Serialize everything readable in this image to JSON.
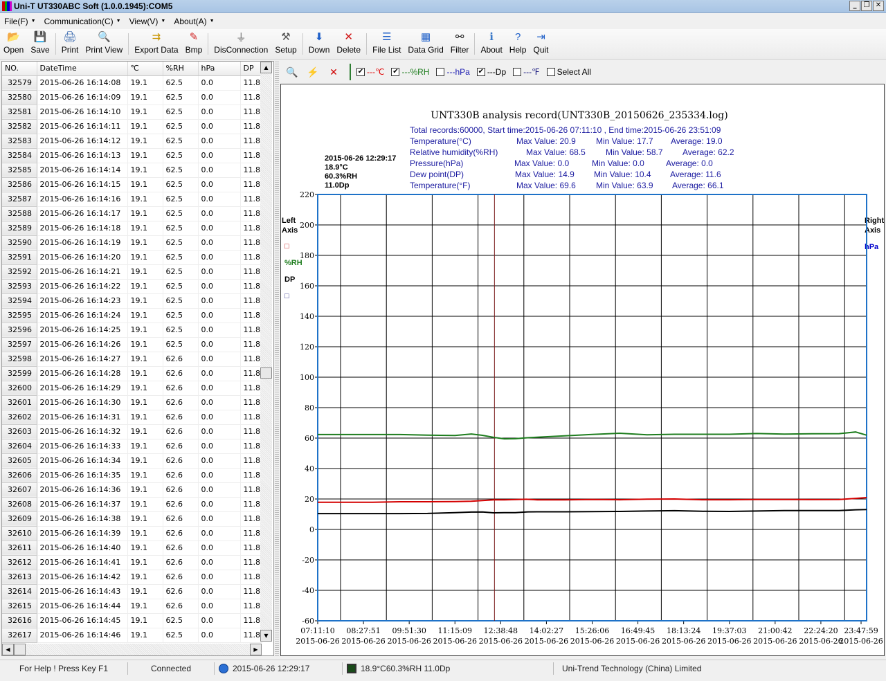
{
  "window": {
    "title": "Uni-T UT330ABC Soft (1.0.0.1945):COM5",
    "controls": {
      "minimize": "_",
      "restore": "❐",
      "close": "✕"
    }
  },
  "menu": [
    {
      "label": "File(F)"
    },
    {
      "label": "Communication(C)"
    },
    {
      "label": "View(V)"
    },
    {
      "label": "About(A)"
    }
  ],
  "toolbar": [
    {
      "id": "open",
      "label": "Open",
      "icon": "folder-open-icon",
      "glyph": "📂"
    },
    {
      "id": "save",
      "label": "Save",
      "icon": "floppy-icon",
      "glyph": "💾"
    },
    {
      "sep": true
    },
    {
      "id": "print",
      "label": "Print",
      "icon": "printer-icon",
      "glyph": "🖨"
    },
    {
      "id": "print-view",
      "label": "Print View",
      "icon": "print-preview-icon",
      "glyph": "🔍"
    },
    {
      "sep": true
    },
    {
      "id": "export-data",
      "label": "Export Data",
      "icon": "export-icon",
      "glyph": "⇉"
    },
    {
      "id": "bmp",
      "label": "Bmp",
      "icon": "paint-icon",
      "glyph": "✎"
    },
    {
      "sep": true
    },
    {
      "id": "disconnection",
      "label": "DisConnection",
      "icon": "usb-plug-icon",
      "glyph": "⏚"
    },
    {
      "id": "setup",
      "label": "Setup",
      "icon": "hammer-icon",
      "glyph": "⚒"
    },
    {
      "sep": true
    },
    {
      "id": "down",
      "label": "Down",
      "icon": "arrow-down-icon",
      "glyph": "⬇"
    },
    {
      "id": "delete",
      "label": "Delete",
      "icon": "delete-x-icon",
      "glyph": "✕"
    },
    {
      "sep": true
    },
    {
      "id": "file-list",
      "label": "File List",
      "icon": "file-tree-icon",
      "glyph": "☰"
    },
    {
      "id": "data-grid",
      "label": "Data Grid",
      "icon": "grid-icon",
      "glyph": "▦"
    },
    {
      "id": "filter",
      "label": "Filter",
      "icon": "binoculars-icon",
      "glyph": "⚯"
    },
    {
      "sep": true
    },
    {
      "id": "about",
      "label": "About",
      "icon": "info-icon",
      "glyph": "ℹ"
    },
    {
      "id": "help",
      "label": "Help",
      "icon": "help-icon",
      "glyph": "?"
    },
    {
      "id": "quit",
      "label": "Quit",
      "icon": "exit-door-icon",
      "glyph": "⇥"
    }
  ],
  "grid": {
    "columns": [
      "NO.",
      "DateTime",
      "℃",
      "%RH",
      "hPa",
      "DP"
    ],
    "rows": [
      [
        "32579",
        "2015-06-26 16:14:08",
        "19.1",
        "62.5",
        "0.0",
        "11.8"
      ],
      [
        "32580",
        "2015-06-26 16:14:09",
        "19.1",
        "62.5",
        "0.0",
        "11.8"
      ],
      [
        "32581",
        "2015-06-26 16:14:10",
        "19.1",
        "62.5",
        "0.0",
        "11.8"
      ],
      [
        "32582",
        "2015-06-26 16:14:11",
        "19.1",
        "62.5",
        "0.0",
        "11.8"
      ],
      [
        "32583",
        "2015-06-26 16:14:12",
        "19.1",
        "62.5",
        "0.0",
        "11.8"
      ],
      [
        "32584",
        "2015-06-26 16:14:13",
        "19.1",
        "62.5",
        "0.0",
        "11.8"
      ],
      [
        "32585",
        "2015-06-26 16:14:14",
        "19.1",
        "62.5",
        "0.0",
        "11.8"
      ],
      [
        "32586",
        "2015-06-26 16:14:15",
        "19.1",
        "62.5",
        "0.0",
        "11.8"
      ],
      [
        "32587",
        "2015-06-26 16:14:16",
        "19.1",
        "62.5",
        "0.0",
        "11.8"
      ],
      [
        "32588",
        "2015-06-26 16:14:17",
        "19.1",
        "62.5",
        "0.0",
        "11.8"
      ],
      [
        "32589",
        "2015-06-26 16:14:18",
        "19.1",
        "62.5",
        "0.0",
        "11.8"
      ],
      [
        "32590",
        "2015-06-26 16:14:19",
        "19.1",
        "62.5",
        "0.0",
        "11.8"
      ],
      [
        "32591",
        "2015-06-26 16:14:20",
        "19.1",
        "62.5",
        "0.0",
        "11.8"
      ],
      [
        "32592",
        "2015-06-26 16:14:21",
        "19.1",
        "62.5",
        "0.0",
        "11.8"
      ],
      [
        "32593",
        "2015-06-26 16:14:22",
        "19.1",
        "62.5",
        "0.0",
        "11.8"
      ],
      [
        "32594",
        "2015-06-26 16:14:23",
        "19.1",
        "62.5",
        "0.0",
        "11.8"
      ],
      [
        "32595",
        "2015-06-26 16:14:24",
        "19.1",
        "62.5",
        "0.0",
        "11.8"
      ],
      [
        "32596",
        "2015-06-26 16:14:25",
        "19.1",
        "62.5",
        "0.0",
        "11.8"
      ],
      [
        "32597",
        "2015-06-26 16:14:26",
        "19.1",
        "62.5",
        "0.0",
        "11.8"
      ],
      [
        "32598",
        "2015-06-26 16:14:27",
        "19.1",
        "62.6",
        "0.0",
        "11.8"
      ],
      [
        "32599",
        "2015-06-26 16:14:28",
        "19.1",
        "62.6",
        "0.0",
        "11.8"
      ],
      [
        "32600",
        "2015-06-26 16:14:29",
        "19.1",
        "62.6",
        "0.0",
        "11.8"
      ],
      [
        "32601",
        "2015-06-26 16:14:30",
        "19.1",
        "62.6",
        "0.0",
        "11.8"
      ],
      [
        "32602",
        "2015-06-26 16:14:31",
        "19.1",
        "62.6",
        "0.0",
        "11.8"
      ],
      [
        "32603",
        "2015-06-26 16:14:32",
        "19.1",
        "62.6",
        "0.0",
        "11.8"
      ],
      [
        "32604",
        "2015-06-26 16:14:33",
        "19.1",
        "62.6",
        "0.0",
        "11.8"
      ],
      [
        "32605",
        "2015-06-26 16:14:34",
        "19.1",
        "62.6",
        "0.0",
        "11.8"
      ],
      [
        "32606",
        "2015-06-26 16:14:35",
        "19.1",
        "62.6",
        "0.0",
        "11.8"
      ],
      [
        "32607",
        "2015-06-26 16:14:36",
        "19.1",
        "62.6",
        "0.0",
        "11.8"
      ],
      [
        "32608",
        "2015-06-26 16:14:37",
        "19.1",
        "62.6",
        "0.0",
        "11.8"
      ],
      [
        "32609",
        "2015-06-26 16:14:38",
        "19.1",
        "62.6",
        "0.0",
        "11.8"
      ],
      [
        "32610",
        "2015-06-26 16:14:39",
        "19.1",
        "62.6",
        "0.0",
        "11.8"
      ],
      [
        "32611",
        "2015-06-26 16:14:40",
        "19.1",
        "62.6",
        "0.0",
        "11.8"
      ],
      [
        "32612",
        "2015-06-26 16:14:41",
        "19.1",
        "62.6",
        "0.0",
        "11.8"
      ],
      [
        "32613",
        "2015-06-26 16:14:42",
        "19.1",
        "62.6",
        "0.0",
        "11.8"
      ],
      [
        "32614",
        "2015-06-26 16:14:43",
        "19.1",
        "62.6",
        "0.0",
        "11.8"
      ],
      [
        "32615",
        "2015-06-26 16:14:44",
        "19.1",
        "62.6",
        "0.0",
        "11.8"
      ],
      [
        "32616",
        "2015-06-26 16:14:45",
        "19.1",
        "62.5",
        "0.0",
        "11.8"
      ],
      [
        "32617",
        "2015-06-26 16:14:46",
        "19.1",
        "62.5",
        "0.0",
        "11.8"
      ]
    ],
    "scroll_position_fraction": 0.54
  },
  "chart_toolbar": {
    "icons": [
      {
        "name": "zoom-data-icon",
        "glyph": "🔍",
        "color": "#1e5fb4"
      },
      {
        "name": "lightning-icon",
        "glyph": "⚡",
        "color": "#e6c800"
      },
      {
        "name": "clear-x-icon",
        "glyph": "✕",
        "color": "#d00000"
      }
    ],
    "series_toggles": [
      {
        "label": "---℃",
        "checked": true,
        "color": "#e00000"
      },
      {
        "label": "---%RH",
        "checked": true,
        "color": "#1e7d1e"
      },
      {
        "label": "---hPa",
        "checked": false,
        "color": "#1a1ab0"
      },
      {
        "label": "---Dp",
        "checked": true,
        "color": "#000000"
      },
      {
        "label": "---℉",
        "checked": false,
        "color": "#1a1a80"
      }
    ],
    "select_all": {
      "label": "Select All",
      "checked": false
    },
    "check_glyph": "✔"
  },
  "chart_data": {
    "type": "line",
    "title": "UNT330B analysis record(UNT330B_20150626_235334.log)",
    "summary": {
      "header": "Total records:60000,  Start time:2015-06-26 07:11:10 ,  End time:2015-06-26 23:51:09",
      "stats": [
        {
          "name": "Temperature(°C)",
          "max": "Max Value:  20.9",
          "min": "Min Value:  17.7",
          "avg": "Average:  19.0"
        },
        {
          "name": "Relative humidity(%RH)",
          "max": "Max Value:  68.5",
          "min": "Min Value:  58.7",
          "avg": "Average:  62.2"
        },
        {
          "name": "Pressure(hPa)",
          "max": "Max Value:   0.0",
          "min": "Min Value:   0.0",
          "avg": "Average:   0.0"
        },
        {
          "name": "Dew point(DP)",
          "max": "Max Value:  14.9",
          "min": "Min Value:  10.4",
          "avg": "Average:  11.6"
        },
        {
          "name": "Temperature(°F)",
          "max": "Max Value:  69.6",
          "min": "Min Value:  63.9",
          "avg": "Average:  66.1"
        }
      ]
    },
    "cursor": {
      "datetime": "2015-06-26 12:29:17",
      "lines": [
        "2015-06-26 12:29:17",
        "18.9°C",
        "60.3%RH",
        "11.0Dp"
      ],
      "x_fraction": 0.322,
      "color": "#7a1a1a"
    },
    "left_axis": {
      "title": [
        "Left",
        "Axis"
      ],
      "legend": [
        {
          "label": "□",
          "color": "#c00000"
        },
        {
          "label": "%RH",
          "color": "#1e7d1e"
        },
        {
          "label": "DP",
          "color": "#000000"
        },
        {
          "label": "□",
          "color": "#1a1a80"
        }
      ]
    },
    "right_axis": {
      "title": [
        "Right",
        "Axis"
      ],
      "legend": [
        {
          "label": "hPa",
          "color": "#0000cc"
        }
      ]
    },
    "ylim": [
      -60,
      220
    ],
    "yticks": [
      220,
      200,
      180,
      160,
      140,
      120,
      100,
      80,
      60,
      40,
      20,
      0,
      -20,
      -40,
      -60
    ],
    "xticks": [
      {
        "time": "07:11:10",
        "date": "2015-06-26"
      },
      {
        "time": "08:27:51",
        "date": "2015-06-26"
      },
      {
        "time": "09:51:30",
        "date": "2015-06-26"
      },
      {
        "time": "11:15:09",
        "date": "2015-06-26"
      },
      {
        "time": "12:38:48",
        "date": "2015-06-26"
      },
      {
        "time": "14:02:27",
        "date": "2015-06-26"
      },
      {
        "time": "15:26:06",
        "date": "2015-06-26"
      },
      {
        "time": "16:49:45",
        "date": "2015-06-26"
      },
      {
        "time": "18:13:24",
        "date": "2015-06-26"
      },
      {
        "time": "19:37:03",
        "date": "2015-06-26"
      },
      {
        "time": "21:00:42",
        "date": "2015-06-26"
      },
      {
        "time": "22:24:20",
        "date": "2015-06-26"
      },
      {
        "time": "23:47:59",
        "date": "2015-06-26"
      }
    ],
    "x_fraction_samples": [
      0,
      0.05,
      0.1,
      0.15,
      0.2,
      0.25,
      0.28,
      0.3,
      0.32,
      0.34,
      0.36,
      0.38,
      0.4,
      0.45,
      0.5,
      0.55,
      0.6,
      0.65,
      0.7,
      0.75,
      0.8,
      0.85,
      0.9,
      0.95,
      0.98,
      1.0
    ],
    "series": [
      {
        "name": "%RH",
        "color": "#1e7d1e",
        "values": [
          62.3,
          62.3,
          62.3,
          62.3,
          61.9,
          61.7,
          62.7,
          61.8,
          60.5,
          59.5,
          59.6,
          60.2,
          60.6,
          61.5,
          62.4,
          63.2,
          62.2,
          62.5,
          62.5,
          62.5,
          63.0,
          62.6,
          62.8,
          62.9,
          64.0,
          61.9
        ]
      },
      {
        "name": "℃",
        "color": "#d40000",
        "values": [
          17.8,
          17.8,
          17.8,
          18.2,
          18.2,
          18.3,
          18.5,
          19.0,
          19.4,
          19.4,
          19.6,
          19.8,
          19.4,
          19.4,
          19.7,
          19.5,
          19.9,
          20.0,
          19.5,
          19.5,
          19.7,
          19.7,
          19.6,
          19.7,
          20.4,
          20.9
        ]
      },
      {
        "name": "DP",
        "color": "#000000",
        "values": [
          10.4,
          10.4,
          10.4,
          10.4,
          10.5,
          11.0,
          11.4,
          11.5,
          10.9,
          11.0,
          11.0,
          11.5,
          11.6,
          11.6,
          11.7,
          11.8,
          12.1,
          12.3,
          11.9,
          11.8,
          12.1,
          12.4,
          12.4,
          12.4,
          12.9,
          13.1
        ]
      }
    ],
    "frame_color": "#1e72c8",
    "grid": true
  },
  "statusbar": {
    "help": "For Help ! Press Key F1",
    "connection": "Connected",
    "time": "2015-06-26 12:29:17",
    "reading": "18.9°C60.3%RH  11.0Dp",
    "company": "Uni-Trend Technology (China) Limited"
  }
}
